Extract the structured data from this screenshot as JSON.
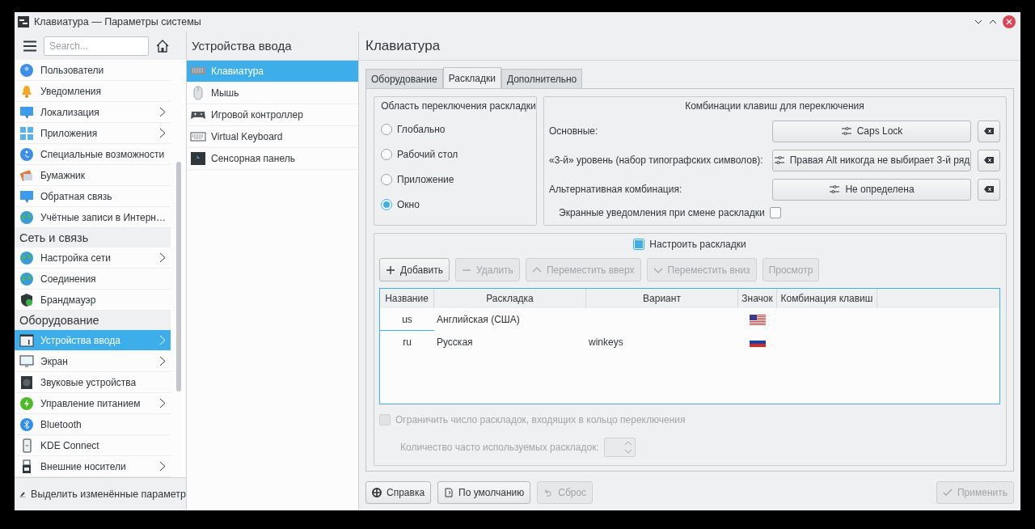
{
  "window": {
    "title": "Клавиатура — Параметры системы"
  },
  "sidebar": {
    "search": {
      "placeholder": "Search..."
    },
    "items": [
      {
        "kind": "item",
        "label": "Пользователи",
        "has_children": false,
        "selected": false
      },
      {
        "kind": "item",
        "label": "Уведомления",
        "has_children": false,
        "selected": false
      },
      {
        "kind": "item",
        "label": "Локализация",
        "has_children": true,
        "selected": false
      },
      {
        "kind": "item",
        "label": "Приложения",
        "has_children": true,
        "selected": false
      },
      {
        "kind": "item",
        "label": "Специальные возможности",
        "has_children": false,
        "selected": false
      },
      {
        "kind": "item",
        "label": "Бумажник",
        "has_children": false,
        "selected": false
      },
      {
        "kind": "item",
        "label": "Обратная связь",
        "has_children": false,
        "selected": false
      },
      {
        "kind": "item",
        "label": "Учётные записи в Интерн…",
        "has_children": false,
        "selected": false
      },
      {
        "kind": "category",
        "label": "Сеть и связь"
      },
      {
        "kind": "item",
        "label": "Настройка сети",
        "has_children": true,
        "selected": false
      },
      {
        "kind": "item",
        "label": "Соединения",
        "has_children": false,
        "selected": false
      },
      {
        "kind": "item",
        "label": "Брандмауэр",
        "has_children": false,
        "selected": false
      },
      {
        "kind": "category",
        "label": "Оборудование"
      },
      {
        "kind": "item",
        "label": "Устройства ввода",
        "has_children": true,
        "selected": true
      },
      {
        "kind": "item",
        "label": "Экран",
        "has_children": true,
        "selected": false
      },
      {
        "kind": "item",
        "label": "Звуковые устройства",
        "has_children": false,
        "selected": false
      },
      {
        "kind": "item",
        "label": "Управление питанием",
        "has_children": true,
        "selected": false
      },
      {
        "kind": "item",
        "label": "Bluetooth",
        "has_children": false,
        "selected": false
      },
      {
        "kind": "item",
        "label": "KDE Connect",
        "has_children": false,
        "selected": false
      },
      {
        "kind": "item",
        "label": "Внешние носители",
        "has_children": true,
        "selected": false
      }
    ],
    "footer": "Выделить изменённые параметр"
  },
  "category_panel": {
    "title": "Устройства ввода",
    "items": [
      {
        "label": "Клавиатура",
        "selected": true
      },
      {
        "label": "Мышь",
        "selected": false
      },
      {
        "label": "Игровой контроллер",
        "selected": false
      },
      {
        "label": "Virtual Keyboard",
        "selected": false
      },
      {
        "label": "Сенсорная панель",
        "selected": false
      }
    ]
  },
  "page": {
    "title": "Клавиатура",
    "tabs": [
      {
        "label": "Оборудование",
        "selected": false
      },
      {
        "label": "Раскладки",
        "selected": true
      },
      {
        "label": "Дополнительно",
        "selected": false
      }
    ],
    "switching_scope": {
      "title": "Область переключения раскладки",
      "options": [
        {
          "label": "Глобально",
          "selected": false
        },
        {
          "label": "Рабочий стол",
          "selected": false
        },
        {
          "label": "Приложение",
          "selected": false
        },
        {
          "label": "Окно",
          "selected": true
        }
      ]
    },
    "shortcuts": {
      "title": "Комбинации клавиш для переключения",
      "rows": [
        {
          "label": "Основные:",
          "value": "Caps Lock"
        },
        {
          "label": "«3-й» уровень (набор типографских символов):",
          "value": "Правая Alt никогда не выбирает 3-й ряд"
        },
        {
          "label": "Альтернативная комбинация:",
          "value": "Не определена"
        }
      ],
      "osd": {
        "label": "Экранные уведомления при смене раскладки",
        "checked": false
      }
    },
    "layouts": {
      "configure": {
        "label": "Настроить раскладки",
        "checked": true
      },
      "toolbar": [
        {
          "label": "Добавить",
          "disabled": false
        },
        {
          "label": "Удалить",
          "disabled": true
        },
        {
          "label": "Переместить вверх",
          "disabled": true
        },
        {
          "label": "Переместить вниз",
          "disabled": true
        },
        {
          "label": "Просмотр",
          "disabled": true
        }
      ],
      "columns": [
        "Название",
        "Раскладка",
        "Вариант",
        "Значок",
        "Комбинация клавиш"
      ],
      "rows": [
        {
          "name": "us",
          "layout": "Английская (США)",
          "current": true
        },
        {
          "name": "ru",
          "layout": "Русская",
          "variant": "winkeys",
          "current": false
        }
      ],
      "limit": {
        "label": "Ограничить число раскладок, входящих в кольцо переключения",
        "checked": false,
        "disabled": true
      },
      "spin": {
        "label": "Количество часто используемых раскладок:",
        "disabled": true
      }
    }
  },
  "buttons": [
    {
      "label": "Справка",
      "disabled": false
    },
    {
      "label": "По умолчанию",
      "disabled": false
    },
    {
      "label": "Сброс",
      "disabled": true
    },
    {
      "label": "Применить",
      "disabled": true
    }
  ]
}
